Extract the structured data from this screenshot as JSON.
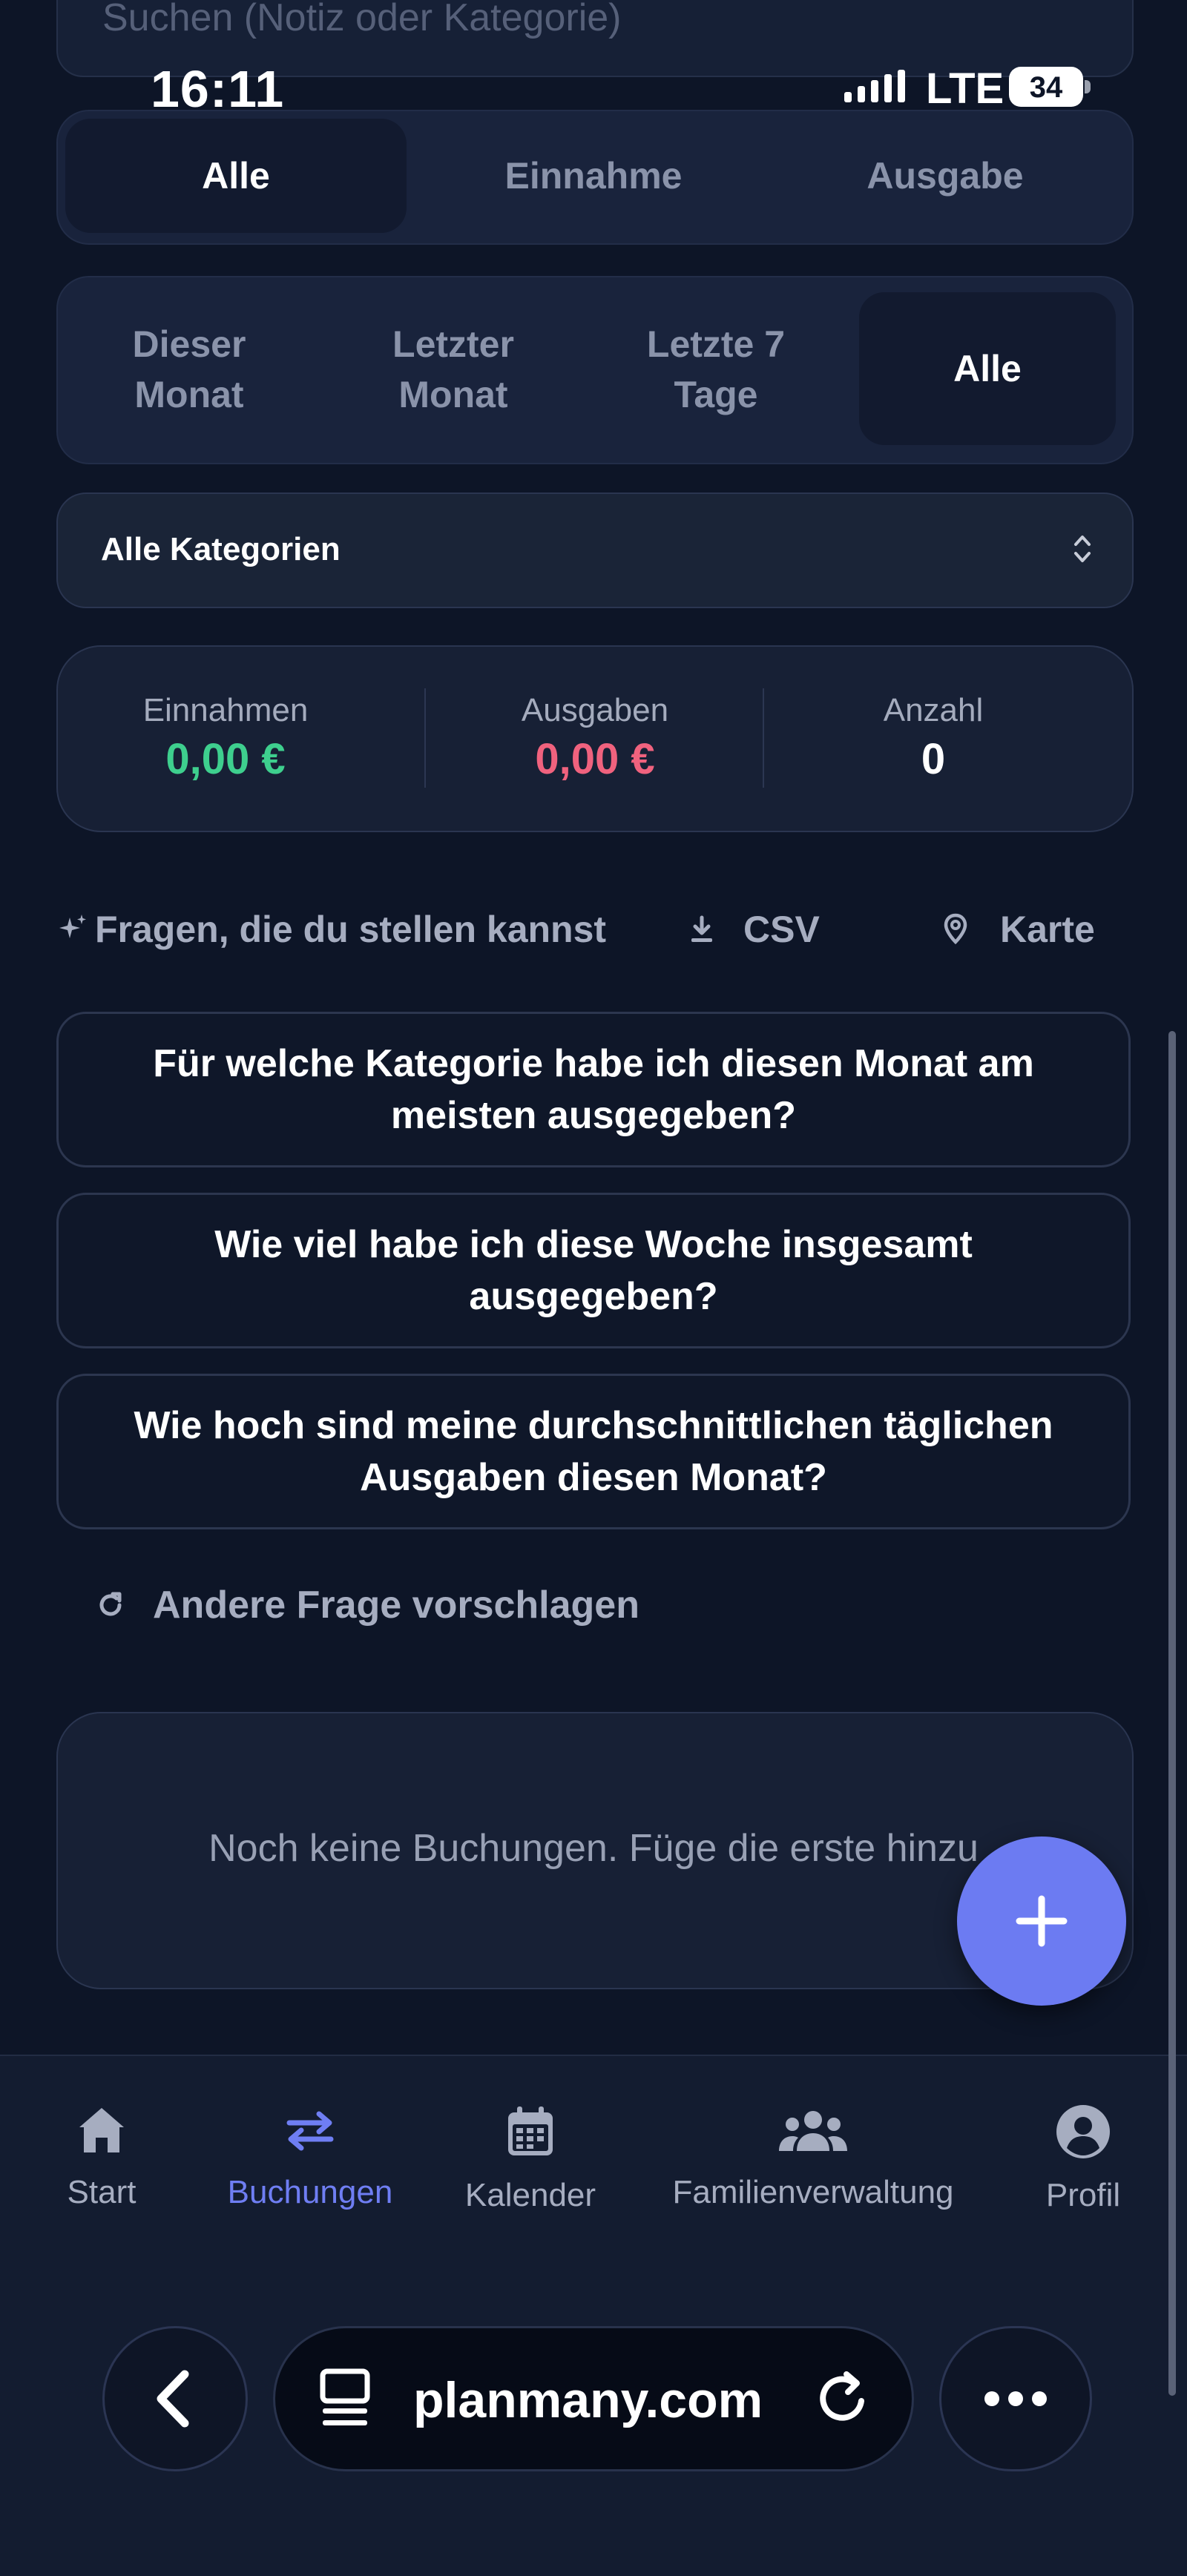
{
  "status_bar": {
    "time": "16:11",
    "network": "LTE",
    "battery": "34"
  },
  "search": {
    "placeholder": "Suchen (Notiz oder Kategorie)"
  },
  "type_tabs": [
    {
      "label": "Alle",
      "active": true
    },
    {
      "label": "Einnahme",
      "active": false
    },
    {
      "label": "Ausgabe",
      "active": false
    }
  ],
  "period_tabs": [
    {
      "label": "Dieser Monat",
      "active": false
    },
    {
      "label": "Letzter Monat",
      "active": false
    },
    {
      "label": "Letzte 7 Tage",
      "active": false
    },
    {
      "label": "Alle",
      "active": true
    }
  ],
  "category_filter": {
    "selected": "Alle Kategorien"
  },
  "summary": {
    "income_label": "Einnahmen",
    "income_value": "0,00 €",
    "expense_label": "Ausgaben",
    "expense_value": "0,00 €",
    "count_label": "Anzahl",
    "count_value": "0"
  },
  "actions": {
    "ask_label": "Fragen, die du stellen kannst",
    "csv_label": "CSV",
    "map_label": "Karte"
  },
  "questions": [
    "Für welche Kategorie habe ich diesen Monat am meisten ausgegeben?",
    "Wie viel habe ich diese Woche insgesamt ausgegeben?",
    "Wie hoch sind meine durchschnittlichen täglichen Ausgaben diesen Monat?"
  ],
  "suggest_label": "Andere Frage vorschlagen",
  "empty_state": "Noch keine Buchungen. Füge die erste hinzu",
  "bottom_nav": [
    {
      "label": "Start",
      "icon": "home-icon",
      "active": false
    },
    {
      "label": "Buchungen",
      "icon": "transfer-icon",
      "active": true
    },
    {
      "label": "Kalender",
      "icon": "calendar-icon",
      "active": false
    },
    {
      "label": "Familienverwaltung",
      "icon": "family-icon",
      "active": false
    },
    {
      "label": "Profil",
      "icon": "profile-icon",
      "active": false
    }
  ],
  "browser": {
    "url": "planmany.com"
  },
  "colors": {
    "accent": "#6c7bf2",
    "income": "#3ecf8e",
    "expense": "#f0627e",
    "background": "#0d1527"
  }
}
